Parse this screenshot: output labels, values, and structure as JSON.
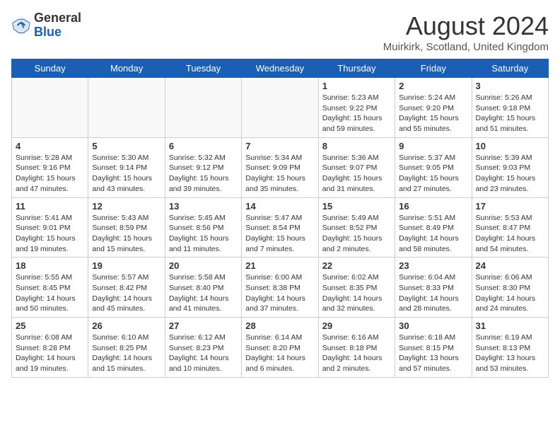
{
  "header": {
    "logo_general": "General",
    "logo_blue": "Blue",
    "month_title": "August 2024",
    "location": "Muirkirk, Scotland, United Kingdom"
  },
  "days_of_week": [
    "Sunday",
    "Monday",
    "Tuesday",
    "Wednesday",
    "Thursday",
    "Friday",
    "Saturday"
  ],
  "weeks": [
    [
      {
        "day": "",
        "info": ""
      },
      {
        "day": "",
        "info": ""
      },
      {
        "day": "",
        "info": ""
      },
      {
        "day": "",
        "info": ""
      },
      {
        "day": "1",
        "info": "Sunrise: 5:23 AM\nSunset: 9:22 PM\nDaylight: 15 hours\nand 59 minutes."
      },
      {
        "day": "2",
        "info": "Sunrise: 5:24 AM\nSunset: 9:20 PM\nDaylight: 15 hours\nand 55 minutes."
      },
      {
        "day": "3",
        "info": "Sunrise: 5:26 AM\nSunset: 9:18 PM\nDaylight: 15 hours\nand 51 minutes."
      }
    ],
    [
      {
        "day": "4",
        "info": "Sunrise: 5:28 AM\nSunset: 9:16 PM\nDaylight: 15 hours\nand 47 minutes."
      },
      {
        "day": "5",
        "info": "Sunrise: 5:30 AM\nSunset: 9:14 PM\nDaylight: 15 hours\nand 43 minutes."
      },
      {
        "day": "6",
        "info": "Sunrise: 5:32 AM\nSunset: 9:12 PM\nDaylight: 15 hours\nand 39 minutes."
      },
      {
        "day": "7",
        "info": "Sunrise: 5:34 AM\nSunset: 9:09 PM\nDaylight: 15 hours\nand 35 minutes."
      },
      {
        "day": "8",
        "info": "Sunrise: 5:36 AM\nSunset: 9:07 PM\nDaylight: 15 hours\nand 31 minutes."
      },
      {
        "day": "9",
        "info": "Sunrise: 5:37 AM\nSunset: 9:05 PM\nDaylight: 15 hours\nand 27 minutes."
      },
      {
        "day": "10",
        "info": "Sunrise: 5:39 AM\nSunset: 9:03 PM\nDaylight: 15 hours\nand 23 minutes."
      }
    ],
    [
      {
        "day": "11",
        "info": "Sunrise: 5:41 AM\nSunset: 9:01 PM\nDaylight: 15 hours\nand 19 minutes."
      },
      {
        "day": "12",
        "info": "Sunrise: 5:43 AM\nSunset: 8:59 PM\nDaylight: 15 hours\nand 15 minutes."
      },
      {
        "day": "13",
        "info": "Sunrise: 5:45 AM\nSunset: 8:56 PM\nDaylight: 15 hours\nand 11 minutes."
      },
      {
        "day": "14",
        "info": "Sunrise: 5:47 AM\nSunset: 8:54 PM\nDaylight: 15 hours\nand 7 minutes."
      },
      {
        "day": "15",
        "info": "Sunrise: 5:49 AM\nSunset: 8:52 PM\nDaylight: 15 hours\nand 2 minutes."
      },
      {
        "day": "16",
        "info": "Sunrise: 5:51 AM\nSunset: 8:49 PM\nDaylight: 14 hours\nand 58 minutes."
      },
      {
        "day": "17",
        "info": "Sunrise: 5:53 AM\nSunset: 8:47 PM\nDaylight: 14 hours\nand 54 minutes."
      }
    ],
    [
      {
        "day": "18",
        "info": "Sunrise: 5:55 AM\nSunset: 8:45 PM\nDaylight: 14 hours\nand 50 minutes."
      },
      {
        "day": "19",
        "info": "Sunrise: 5:57 AM\nSunset: 8:42 PM\nDaylight: 14 hours\nand 45 minutes."
      },
      {
        "day": "20",
        "info": "Sunrise: 5:58 AM\nSunset: 8:40 PM\nDaylight: 14 hours\nand 41 minutes."
      },
      {
        "day": "21",
        "info": "Sunrise: 6:00 AM\nSunset: 8:38 PM\nDaylight: 14 hours\nand 37 minutes."
      },
      {
        "day": "22",
        "info": "Sunrise: 6:02 AM\nSunset: 8:35 PM\nDaylight: 14 hours\nand 32 minutes."
      },
      {
        "day": "23",
        "info": "Sunrise: 6:04 AM\nSunset: 8:33 PM\nDaylight: 14 hours\nand 28 minutes."
      },
      {
        "day": "24",
        "info": "Sunrise: 6:06 AM\nSunset: 8:30 PM\nDaylight: 14 hours\nand 24 minutes."
      }
    ],
    [
      {
        "day": "25",
        "info": "Sunrise: 6:08 AM\nSunset: 8:28 PM\nDaylight: 14 hours\nand 19 minutes."
      },
      {
        "day": "26",
        "info": "Sunrise: 6:10 AM\nSunset: 8:25 PM\nDaylight: 14 hours\nand 15 minutes."
      },
      {
        "day": "27",
        "info": "Sunrise: 6:12 AM\nSunset: 8:23 PM\nDaylight: 14 hours\nand 10 minutes."
      },
      {
        "day": "28",
        "info": "Sunrise: 6:14 AM\nSunset: 8:20 PM\nDaylight: 14 hours\nand 6 minutes."
      },
      {
        "day": "29",
        "info": "Sunrise: 6:16 AM\nSunset: 8:18 PM\nDaylight: 14 hours\nand 2 minutes."
      },
      {
        "day": "30",
        "info": "Sunrise: 6:18 AM\nSunset: 8:15 PM\nDaylight: 13 hours\nand 57 minutes."
      },
      {
        "day": "31",
        "info": "Sunrise: 6:19 AM\nSunset: 8:13 PM\nDaylight: 13 hours\nand 53 minutes."
      }
    ]
  ]
}
